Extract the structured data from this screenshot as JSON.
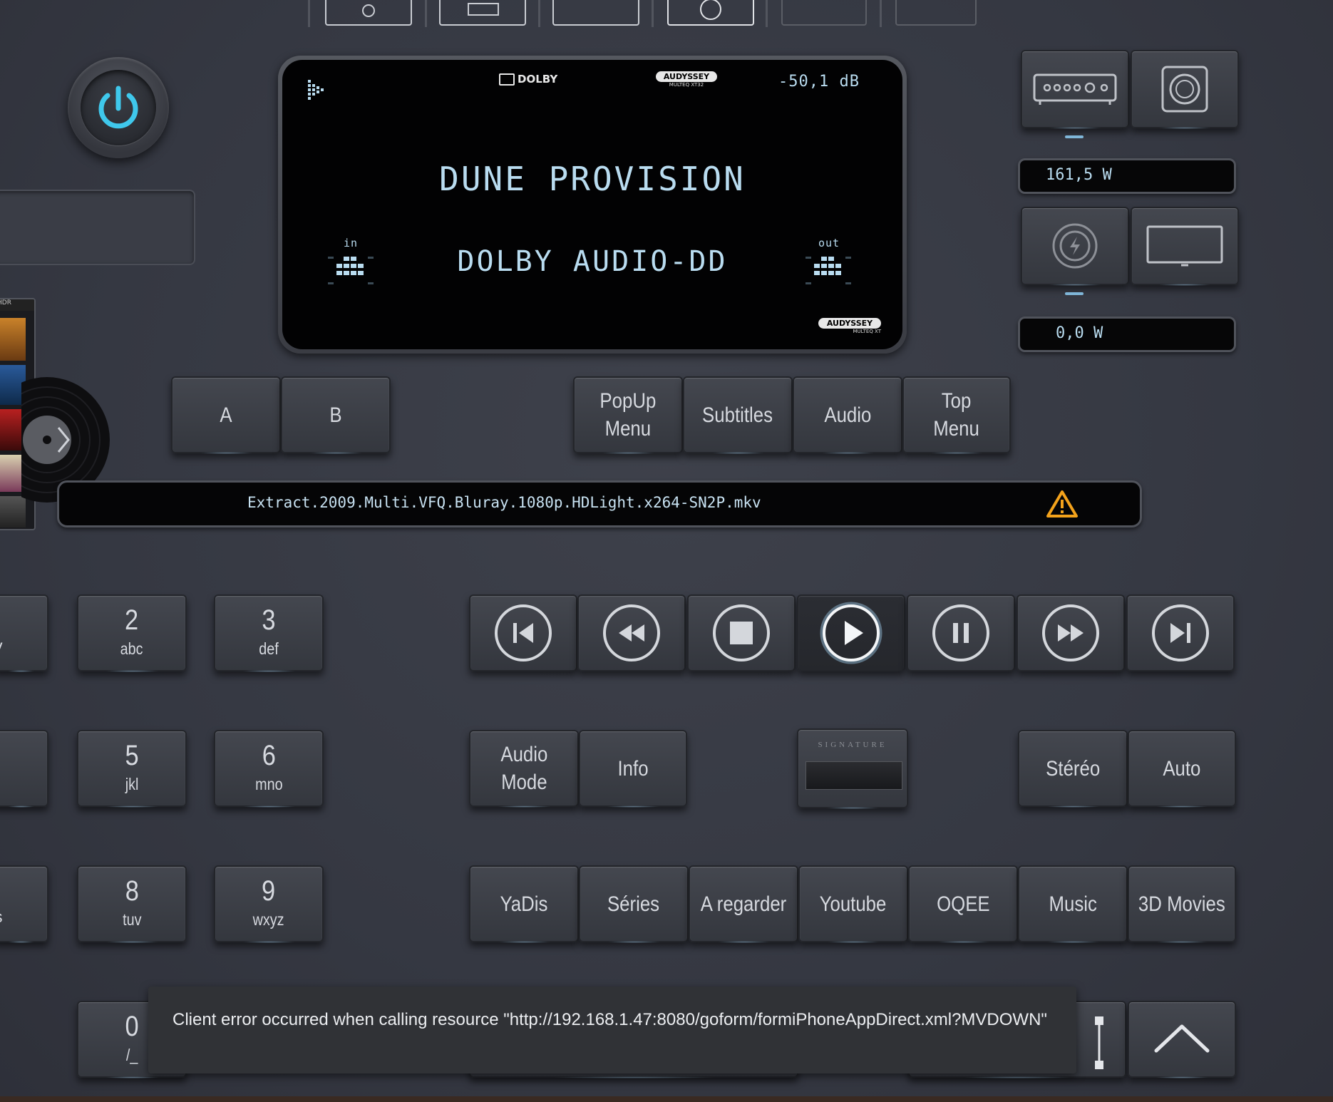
{
  "display": {
    "volume": "-50,1 dB",
    "source": "DUNE PROVISION",
    "audio_format": "DOLBY AUDIO-DD",
    "in_label": "in",
    "out_label": "out",
    "logo_dolby": "DOLBY",
    "logo_audyssey": "AUDYSSEY",
    "logo_audyssey_sub": "MULTEQ XT32",
    "logo_audyssey_bottom": "AUDYSSEY",
    "logo_audyssey_bottom_sub": "MULTEQ XT"
  },
  "power_meters": {
    "meter1": "161,5 W",
    "meter2": "0,0 W"
  },
  "album": {
    "hdr": "HDR"
  },
  "zone_buttons": [
    "A",
    "B"
  ],
  "disc_buttons": [
    "PopUp\nMenu",
    "Subtitles",
    "Audio",
    "Top\nMenu"
  ],
  "filename": "Extract.2009.Multi.VFQ.Bluray.1080p.HDLight.x264-SN2P.mkv",
  "keypad": [
    {
      "num": "2",
      "letters": "abc"
    },
    {
      "num": "3",
      "letters": "def"
    },
    {
      "num": "5",
      "letters": "jkl"
    },
    {
      "num": "6",
      "letters": "mno"
    },
    {
      "num": "8",
      "letters": "tuv"
    },
    {
      "num": "9",
      "letters": "wxyz"
    },
    {
      "num": "0",
      "letters": "/_"
    }
  ],
  "keypad_partial": [
    "y",
    "",
    "s"
  ],
  "transport_icons": [
    "skip-previous-icon",
    "rewind-icon",
    "stop-icon",
    "play-icon",
    "pause-icon",
    "fast-forward-icon",
    "skip-next-icon"
  ],
  "mode_buttons": {
    "audio_mode": "Audio\nMode",
    "info": "Info",
    "stereo": "Stéréo",
    "auto": "Auto",
    "amp_brand": "SIGNATURE"
  },
  "shortcuts": [
    "YaDis",
    "Séries",
    "A regarder",
    "Youtube",
    "OQEE",
    "Music",
    "3D Movies"
  ],
  "toast": {
    "message": "Client error occurred when calling resource \"http://192.168.1.47:8080/goform/formiPhoneAppDirect.xml?MVDOWN\""
  },
  "colors": {
    "power_accent": "#3fc8ec",
    "lcd_text": "#b9dcf0",
    "warning": "#f3a21b",
    "background": "#383b45"
  }
}
